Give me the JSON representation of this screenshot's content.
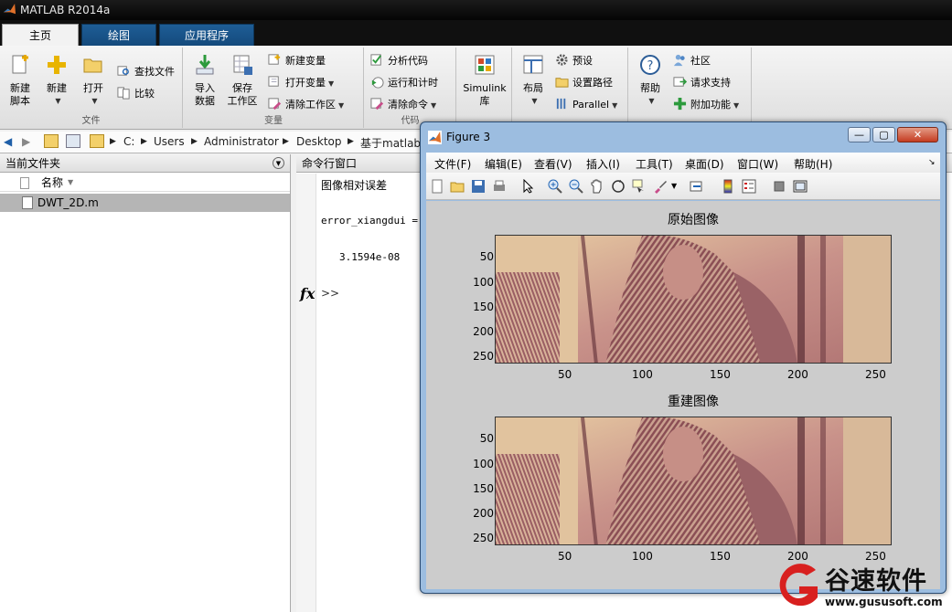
{
  "window": {
    "title": "MATLAB R2014a"
  },
  "tabs": [
    "主页",
    "绘图",
    "应用程序"
  ],
  "ribbon": {
    "file": {
      "new_script": [
        "新建",
        "脚本"
      ],
      "new": "新建",
      "open": "打开",
      "find_files": "查找文件",
      "compare": "比较",
      "label": "文件"
    },
    "variable": {
      "import": [
        "导入",
        "数据"
      ],
      "save": [
        "保存",
        "工作区"
      ],
      "new_var": "新建变量",
      "open_var": "打开变量",
      "clear_ws": "清除工作区",
      "label": "变量"
    },
    "code": {
      "analyze": "分析代码",
      "run_time": "运行和计时",
      "clear_cmd": "清除命令",
      "label": "代码"
    },
    "simulink": {
      "lib": [
        "Simulink",
        "库"
      ]
    },
    "env": {
      "layout": "布局",
      "prefs": "预设",
      "set_path": "设置路径",
      "parallel": "Parallel"
    },
    "resources": {
      "help": "帮助",
      "community": "社区",
      "support": "请求支持",
      "addons": "附加功能"
    }
  },
  "address": {
    "segments": [
      "C:",
      "Users",
      "Administrator",
      "Desktop",
      "基于matlab"
    ]
  },
  "current_folder": {
    "title": "当前文件夹",
    "column": "名称",
    "files": [
      "DWT_2D.m"
    ]
  },
  "command_window": {
    "title": "命令行窗口",
    "lines": [
      "图像相对误差",
      "error_xiangdui =",
      "3.1594e-08"
    ],
    "fx": "fx",
    "prompt": ">>"
  },
  "figure": {
    "title": "Figure 3",
    "menu": [
      "文件(F)",
      "编辑(E)",
      "查看(V)",
      "插入(I)",
      "工具(T)",
      "桌面(D)",
      "窗口(W)",
      "帮助(H)"
    ],
    "plots": [
      {
        "title": "原始图像",
        "yticks": [
          "50",
          "100",
          "150",
          "200",
          "250"
        ],
        "xticks": [
          "50",
          "100",
          "150",
          "200",
          "250"
        ]
      },
      {
        "title": "重建图像",
        "yticks": [
          "50",
          "100",
          "150",
          "200",
          "250"
        ],
        "xticks": [
          "50",
          "100",
          "150",
          "200",
          "250"
        ]
      }
    ]
  },
  "watermark": {
    "brand": "谷速软件",
    "url": "www.gususoft.com"
  },
  "colors": {
    "tab_blue": "#1e5d96",
    "fig_frame": "#9cbde0",
    "accent_red": "#d8201f"
  }
}
